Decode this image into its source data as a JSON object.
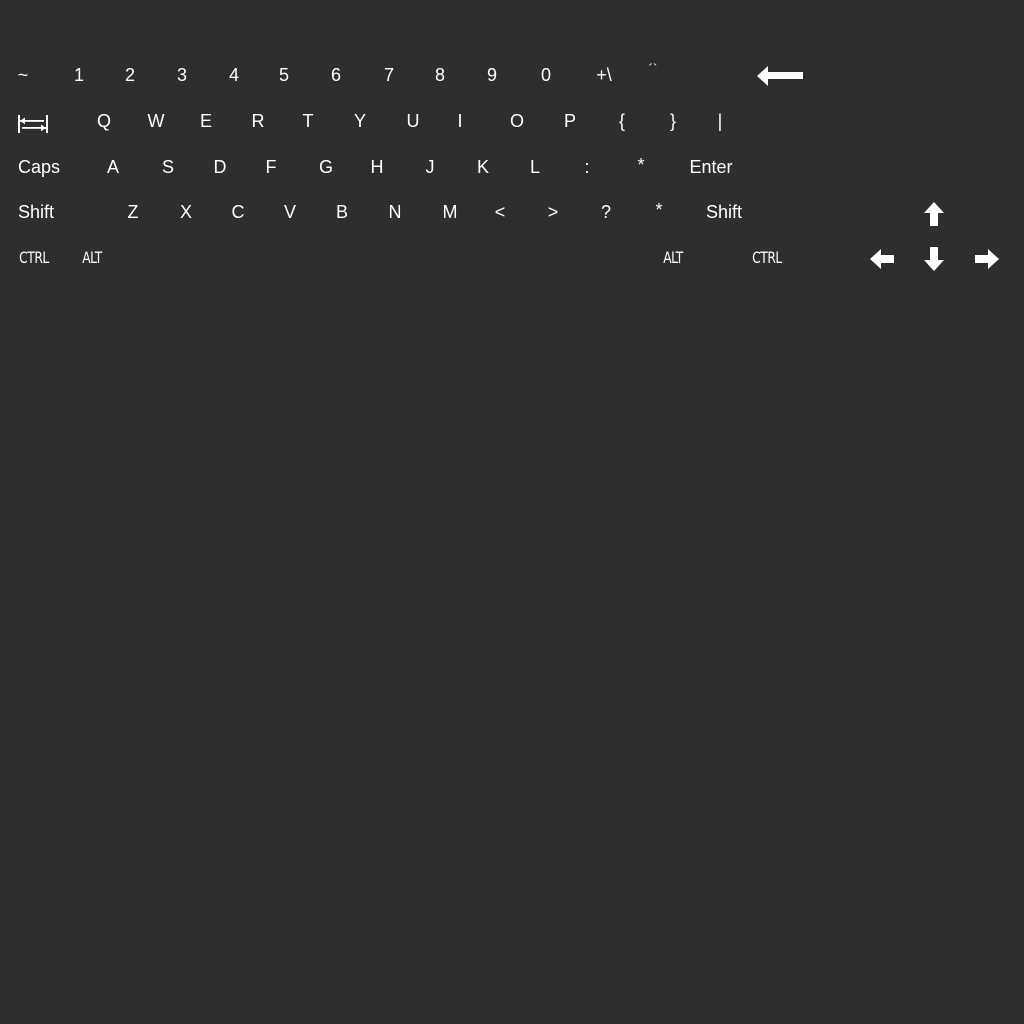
{
  "keyboard": {
    "row1": {
      "tilde": "~",
      "k1": "1",
      "k2": "2",
      "k3": "3",
      "k4": "4",
      "k5": "5",
      "k6": "6",
      "k7": "7",
      "k8": "8",
      "k9": "9",
      "k0": "0",
      "plus_backslash": "+\\",
      "accents": "´`",
      "backspace_icon": "backspace-arrow-icon"
    },
    "row2": {
      "tab_icon": "tab-icon",
      "q": "Q",
      "w": "W",
      "e": "E",
      "r": "R",
      "t": "T",
      "y": "Y",
      "u": "U",
      "i": "I",
      "o": "O",
      "p": "P",
      "lbrace": "{",
      "rbrace": "}",
      "pipe": "|"
    },
    "row3": {
      "caps": "Caps",
      "a": "A",
      "s": "S",
      "d": "D",
      "f": "F",
      "g": "G",
      "h": "H",
      "j": "J",
      "k": "K",
      "l": "L",
      "colon": ":",
      "asterisk": "*",
      "enter": "Enter"
    },
    "row4": {
      "shift_left": "Shift",
      "z": "Z",
      "x": "X",
      "c": "C",
      "v": "V",
      "b": "B",
      "n": "N",
      "m": "M",
      "lt": "<",
      "gt": ">",
      "question": "?",
      "asterisk": "*",
      "shift_right": "Shift",
      "arrow_up_icon": "arrow-up-icon"
    },
    "row5": {
      "ctrl_left": "CTRL",
      "alt_left": "ALT",
      "alt_right": "ALT",
      "ctrl_right": "CTRL",
      "arrow_left_icon": "arrow-left-icon",
      "arrow_down_icon": "arrow-down-icon",
      "arrow_right_icon": "arrow-right-icon"
    }
  },
  "colors": {
    "background": "#2e2e2e",
    "key_text": "#ffffff"
  }
}
